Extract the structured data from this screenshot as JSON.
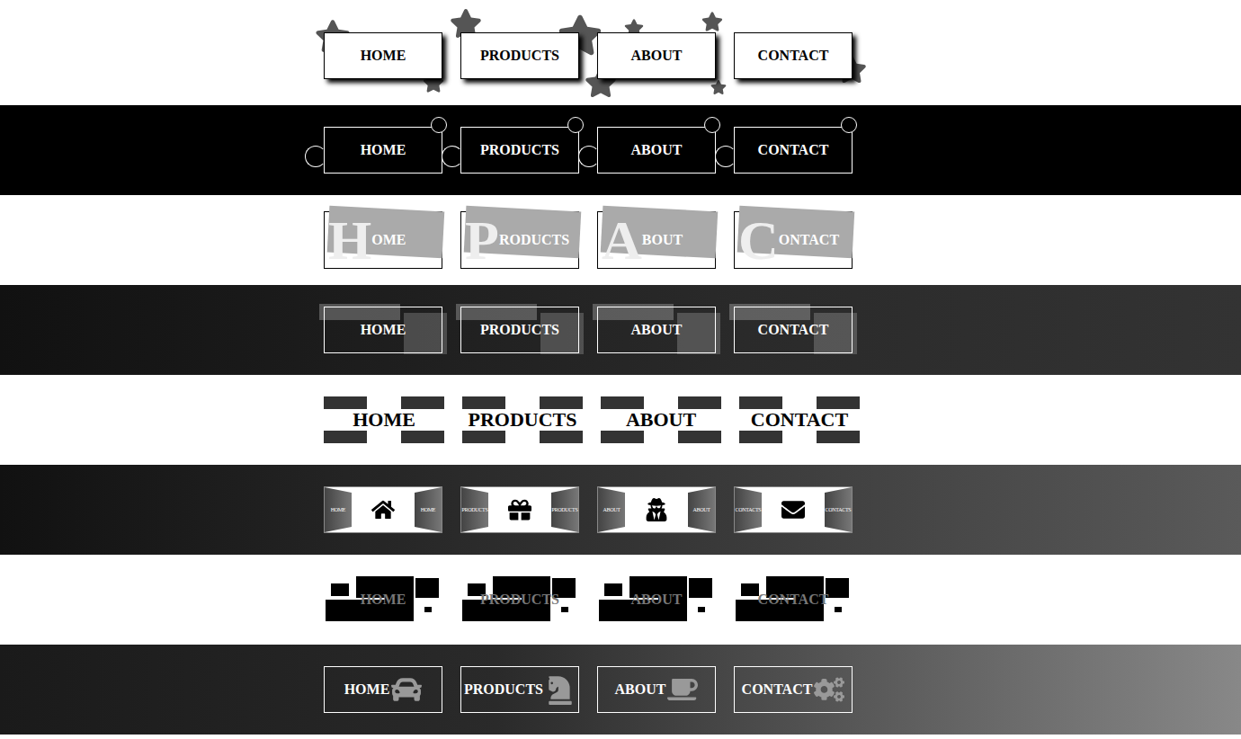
{
  "menus": [
    {
      "kind": "sticker",
      "items": [
        {
          "label": "HOME"
        },
        {
          "label": "PRODUCTS"
        },
        {
          "label": "ABOUT"
        },
        {
          "label": "CONTACT"
        }
      ]
    },
    {
      "kind": "bubble",
      "items": [
        {
          "label": "HOME"
        },
        {
          "label": "PRODUCTS"
        },
        {
          "label": "ABOUT"
        },
        {
          "label": "CONTACT"
        }
      ]
    },
    {
      "kind": "initial",
      "items": [
        {
          "initial": "H",
          "label": "OME"
        },
        {
          "initial": "P",
          "label": "RODUCTS"
        },
        {
          "initial": "A",
          "label": "BOUT"
        },
        {
          "initial": "C",
          "label": "ONTACT"
        }
      ]
    },
    {
      "kind": "glass",
      "items": [
        {
          "label": "HOME"
        },
        {
          "label": "PRODUCTS"
        },
        {
          "label": "ABOUT"
        },
        {
          "label": "CONTACT"
        }
      ]
    },
    {
      "kind": "bars",
      "items": [
        {
          "label": "HOME"
        },
        {
          "label": "PRODUCTS"
        },
        {
          "label": "ABOUT"
        },
        {
          "label": "CONTACT"
        }
      ]
    },
    {
      "kind": "panels",
      "items": [
        {
          "label": "HOME"
        },
        {
          "label": "PRODUCTS"
        },
        {
          "label": "ABOUT"
        },
        {
          "label": "CONTACTS"
        }
      ]
    },
    {
      "kind": "blocks",
      "items": [
        {
          "label": "HOME"
        },
        {
          "label": "PRODUCTS"
        },
        {
          "label": "ABOUT"
        },
        {
          "label": "CONTACT"
        }
      ]
    },
    {
      "kind": "icon",
      "items": [
        {
          "label": "HOME"
        },
        {
          "label": "PRODUCTS"
        },
        {
          "label": "ABOUT"
        },
        {
          "label": "CONTACT"
        }
      ]
    }
  ]
}
